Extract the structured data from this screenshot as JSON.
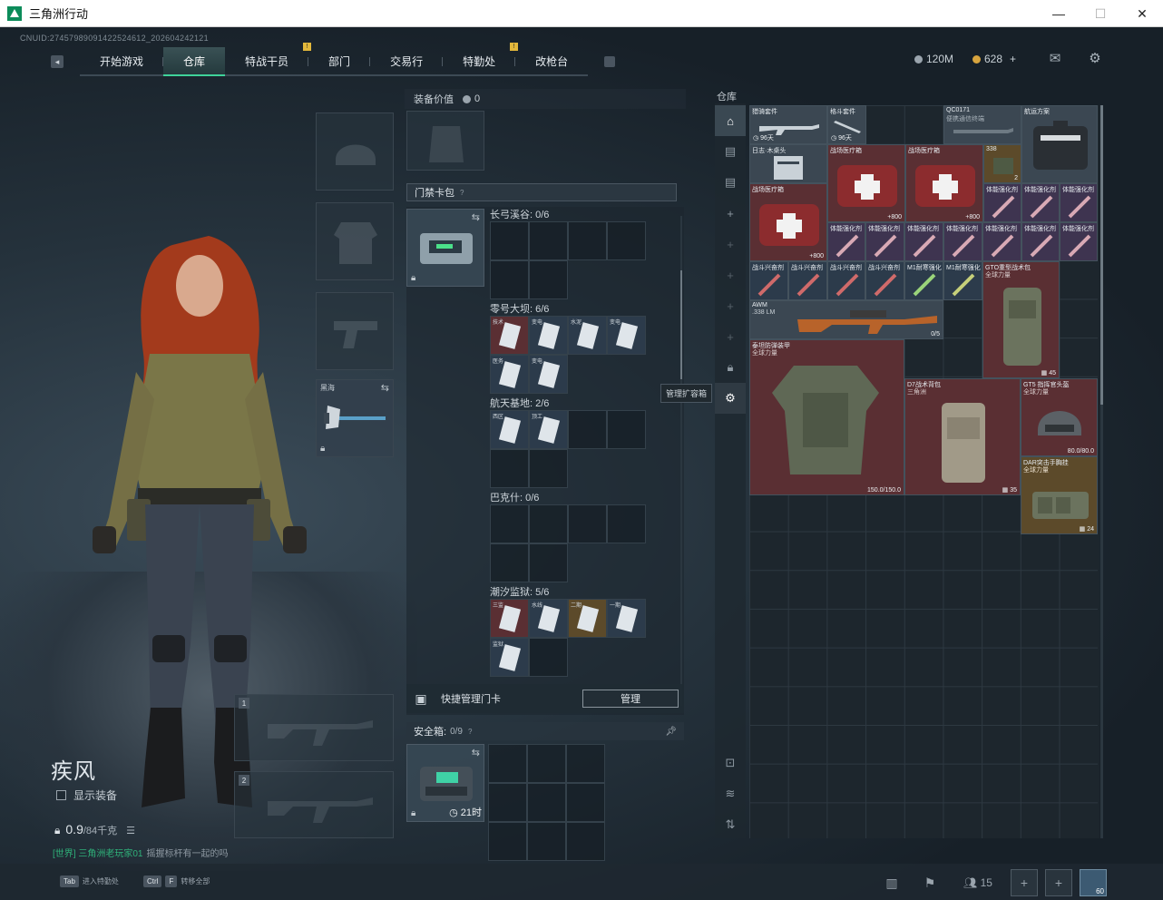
{
  "window": {
    "title": "三角洲行动",
    "minimize": "—",
    "maximize": "☐",
    "close": "✕"
  },
  "uid": "CNUID:2745798909142252461​2_2026042421​21",
  "nav": {
    "tabs": [
      {
        "label": "开始游戏",
        "active": false,
        "badge": ""
      },
      {
        "label": "仓库",
        "active": true,
        "badge": ""
      },
      {
        "label": "特战干员",
        "active": false,
        "badge": "!"
      },
      {
        "label": "部门",
        "active": false,
        "badge": ""
      },
      {
        "label": "交易行",
        "active": false,
        "badge": ""
      },
      {
        "label": "特勤处",
        "active": false,
        "badge": "!"
      },
      {
        "label": "改枪台",
        "active": false,
        "badge": ""
      }
    ]
  },
  "currency": {
    "silver": "120M",
    "gold": "628",
    "plus": "+"
  },
  "icons": {
    "mail": "mail-icon",
    "settings": "gear-icon"
  },
  "character": {
    "name": "疾风",
    "show_equipment": "显示装备",
    "weight": "0.9",
    "weight_max": "/84千克"
  },
  "equipment": {
    "melee_label": "黑海"
  },
  "weapon_slots": [
    "1",
    "2"
  ],
  "world_chat": {
    "channel": "[世界] 三角洲老玩家01",
    "message": "摇握标杆有一起的吗"
  },
  "bottom": {
    "hint1_key": "Tab",
    "hint1": "进入特勤处",
    "hint2_key1": "Ctrl",
    "hint2_key2": "F",
    "hint2": "转移全部",
    "friends_count": "15",
    "avatar_level": "60"
  },
  "mid": {
    "equip_value_label": "装备价值",
    "equip_value": "0",
    "cardpack_label": "门禁卡包",
    "maps": [
      {
        "label": "长弓溪谷: 0/6"
      },
      {
        "label": "零号大坝: 6/6",
        "cards": [
          "技术",
          "变电",
          "水泥",
          "变电",
          "医务",
          "变电"
        ]
      },
      {
        "label": "航天基地: 2/6",
        "cards": [
          "西区",
          "顶工"
        ]
      },
      {
        "label": "巴克什: 0/6"
      },
      {
        "label": "潮汐监狱: 5/6",
        "cards": [
          "三监",
          "水线",
          "二期",
          "一期",
          "监狱"
        ]
      }
    ],
    "quick_manage": "快捷管理门卡",
    "manage_btn": "管理",
    "safebox_label": "安全箱:",
    "safebox_count": "0/9",
    "safebox_timer": "21时",
    "tooltip": "管理扩容箱"
  },
  "warehouse": {
    "label": "仓库",
    "items": [
      {
        "name": "猎骑套件",
        "value": "96天"
      },
      {
        "name": "格斗套件",
        "value": "96天"
      },
      {
        "name": "QC0171",
        "value": "",
        "sub": "便携通信终端"
      },
      {
        "name": "航运方案",
        "value": ""
      },
      {
        "name": "日志·木桌头",
        "value": ""
      },
      {
        "name": "战场医疗箱",
        "value": "800"
      },
      {
        "name": "战场医疗箱",
        "value": "800"
      },
      {
        "name": "338",
        "value": "2"
      },
      {
        "name": "战场医疗箱",
        "value": "800"
      },
      {
        "name": "体能强化剂",
        "value": ""
      },
      {
        "name": "战斗兴奋剂",
        "value": ""
      },
      {
        "name": "M1耐寒强化",
        "value": ""
      },
      {
        "name": "GTO重型战术包",
        "value": "45",
        "sub": "全球力量"
      },
      {
        "name": "AWM",
        "value": "0/5",
        "sub": ".338 LM"
      },
      {
        "name": "泰坦防弹装甲",
        "value": "150.0/150.0",
        "sub": "全球力量"
      },
      {
        "name": "D7战术背包",
        "value": "35",
        "sub": "三角洲"
      },
      {
        "name": "GT5 指挥官头盔",
        "value": "80.0/80.0",
        "sub": "全球力量"
      },
      {
        "name": "DAR突击手胸挂",
        "value": "24",
        "sub": "全球力量"
      }
    ]
  }
}
